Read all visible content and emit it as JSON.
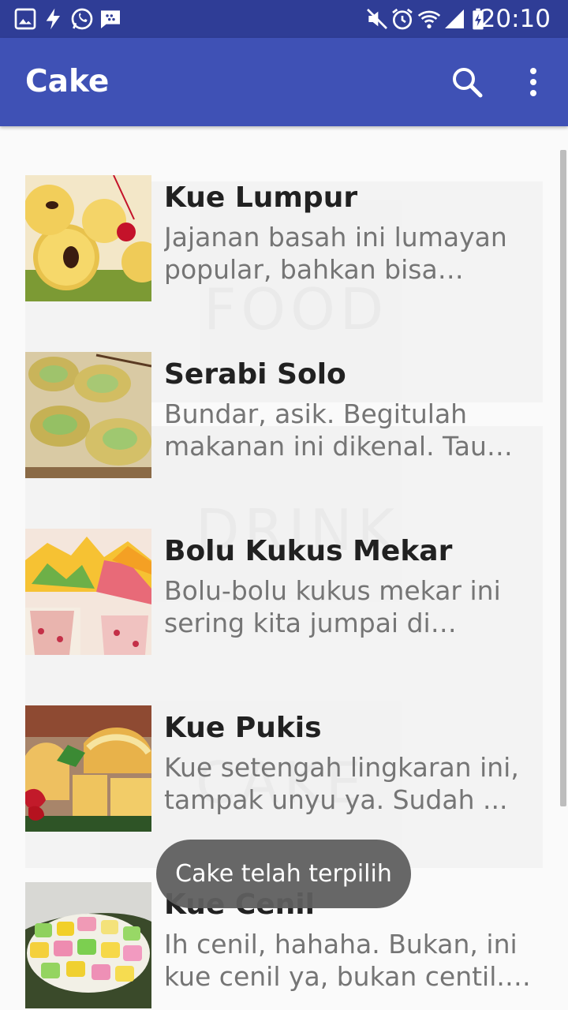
{
  "status_bar": {
    "time": "20:10",
    "left_icons": [
      "image-icon",
      "flash-icon",
      "whatsapp-icon",
      "bbm-icon"
    ],
    "right_icons": [
      "mute-icon",
      "alarm-icon",
      "wifi-icon",
      "signal-icon",
      "battery-charging-icon"
    ]
  },
  "app_bar": {
    "title": "Cake",
    "actions": [
      "search-icon",
      "more-vert-icon"
    ]
  },
  "list": {
    "items": [
      {
        "name": "Kue Lumpur",
        "description": "Jajanan basah ini lumayan popular, bahkan bisa dibilang..."
      },
      {
        "name": "Serabi Solo",
        "description": "Bundar, asik. Begitulah makanan ini dikenal. Tau kan..."
      },
      {
        "name": "Bolu Kukus Mekar",
        "description": "Bolu-bolu kukus mekar ini sering kita jumpai di beberapa..."
      },
      {
        "name": "Kue Pukis",
        "description": "Kue setengah lingkaran ini, tampak unyu ya. Sudah ..."
      },
      {
        "name": "Kue Cenil",
        "description": "Ih cenil, hahaha. Bukan, ini kue cenil ya, bukan centil. Hi..."
      }
    ]
  },
  "toast": {
    "text": "Cake telah terpilih"
  },
  "colors": {
    "status_bar": "#2f3d96",
    "app_bar": "#3f51b5",
    "background": "#fafafa",
    "title_text": "#212121",
    "secondary_text": "#757575"
  }
}
